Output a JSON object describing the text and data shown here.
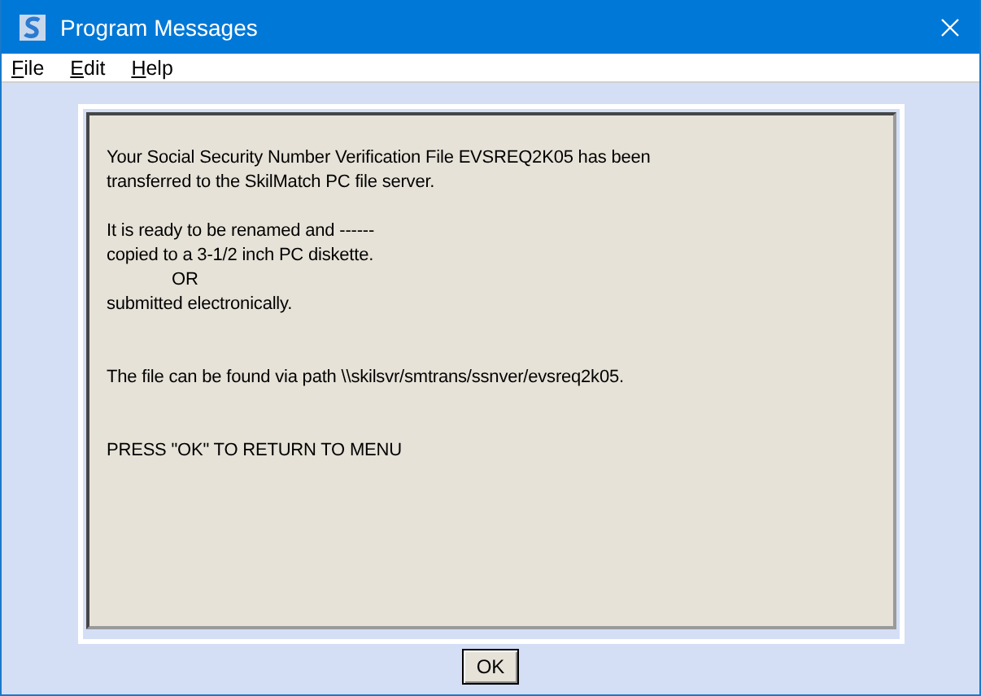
{
  "window": {
    "title": "Program Messages"
  },
  "menu": [
    {
      "label": "File"
    },
    {
      "label": "Edit"
    },
    {
      "label": "Help"
    }
  ],
  "message": [
    {
      "kind": "plain",
      "text": "Your Social Security Number Verification File EVSREQ2K05 has been"
    },
    {
      "kind": "plain",
      "text": "transferred to the SkilMatch PC file server."
    },
    {
      "kind": "blank"
    },
    {
      "kind": "plain",
      "text": "It is ready to be renamed and ------"
    },
    {
      "kind": "plain",
      "text": "copied to a 3-1/2 inch PC diskette."
    },
    {
      "kind": "indented",
      "text": "OR"
    },
    {
      "kind": "plain",
      "text": "submitted electronically."
    },
    {
      "kind": "blank"
    },
    {
      "kind": "blank"
    },
    {
      "kind": "plain",
      "text": "The file can be found via path \\\\skilsvr/smtrans/ssnver/evsreq2k05."
    },
    {
      "kind": "blank"
    },
    {
      "kind": "blank"
    },
    {
      "kind": "plain",
      "text": "PRESS \"OK\" TO RETURN TO MENU"
    }
  ],
  "buttons": [
    {
      "label": "OK"
    }
  ]
}
